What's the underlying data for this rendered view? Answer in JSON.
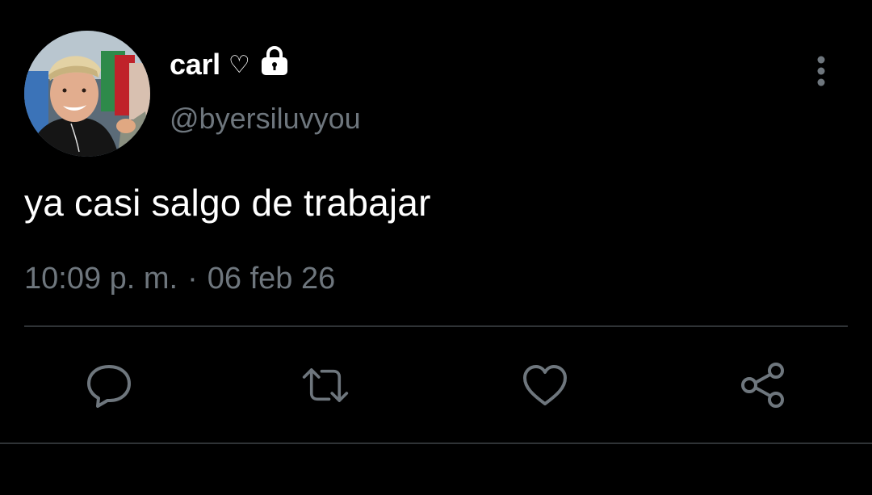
{
  "user": {
    "display_name": "carl",
    "name_emoji": "♡",
    "handle": "@byersiluvyou",
    "avatar_icon": "profile-photo",
    "protected_icon": "lock-icon"
  },
  "tweet": {
    "text": "ya casi salgo de trabajar",
    "time": "10:09 p. m.",
    "separator": "·",
    "date": "06 feb 26"
  },
  "actions": {
    "reply_icon": "reply-icon",
    "retweet_icon": "retweet-icon",
    "like_icon": "heart-icon",
    "share_icon": "share-icon",
    "more_icon": "more-vertical-icon"
  },
  "colors": {
    "background": "#000000",
    "primary_text": "#ffffff",
    "secondary_text": "#6e767d",
    "icon": "#6e767d",
    "divider": "#2f3336"
  }
}
